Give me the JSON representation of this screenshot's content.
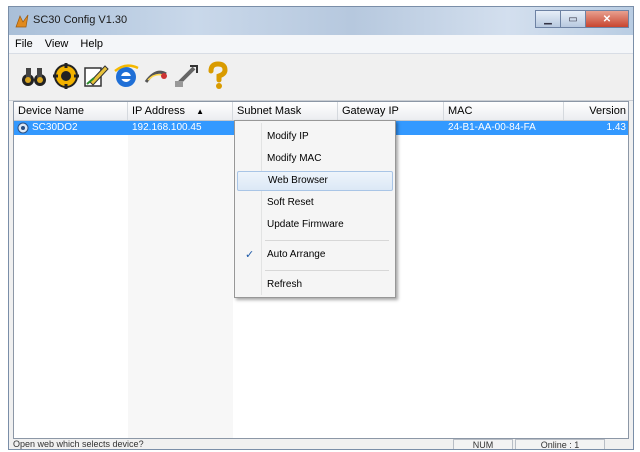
{
  "window": {
    "title": "SC30 Config V1.30"
  },
  "menubar": {
    "items": [
      "File",
      "View",
      "Help"
    ]
  },
  "toolbar": {
    "buttons": [
      {
        "icon": "search-binoculars-icon"
      },
      {
        "icon": "settings-gear-icon"
      },
      {
        "icon": "modify-edit-icon"
      },
      {
        "icon": "web-browser-e-icon"
      },
      {
        "icon": "reset-icon"
      },
      {
        "icon": "update-firmware-icon"
      },
      {
        "icon": "help-question-icon"
      }
    ]
  },
  "list": {
    "columns": [
      {
        "label": "Device Name"
      },
      {
        "label": "IP Address",
        "sort_indicator": "▲"
      },
      {
        "label": "Subnet Mask"
      },
      {
        "label": "Gateway IP"
      },
      {
        "label": "MAC"
      },
      {
        "label": "Version"
      }
    ],
    "rows": [
      {
        "device_name": "SC30DO2",
        "ip_address": "192.168.100.45",
        "subnet_mask": "",
        "gateway_ip": "",
        "mac": "24-B1-AA-00-84-FA",
        "version": "1.43"
      }
    ]
  },
  "context_menu": {
    "items": [
      {
        "label": "Modify IP"
      },
      {
        "label": "Modify MAC"
      },
      {
        "label": "Web Browser"
      },
      {
        "label": "Soft Reset"
      },
      {
        "label": "Update Firmware"
      },
      {
        "label": "Auto Arrange",
        "checked": true
      },
      {
        "label": "Refresh"
      }
    ]
  },
  "status": {
    "message": "Open web which selects device?",
    "num": "NUM",
    "online": "Online : 1"
  },
  "colors": {
    "selection": "#3399ff",
    "menu_hover": "#dce8f6"
  }
}
